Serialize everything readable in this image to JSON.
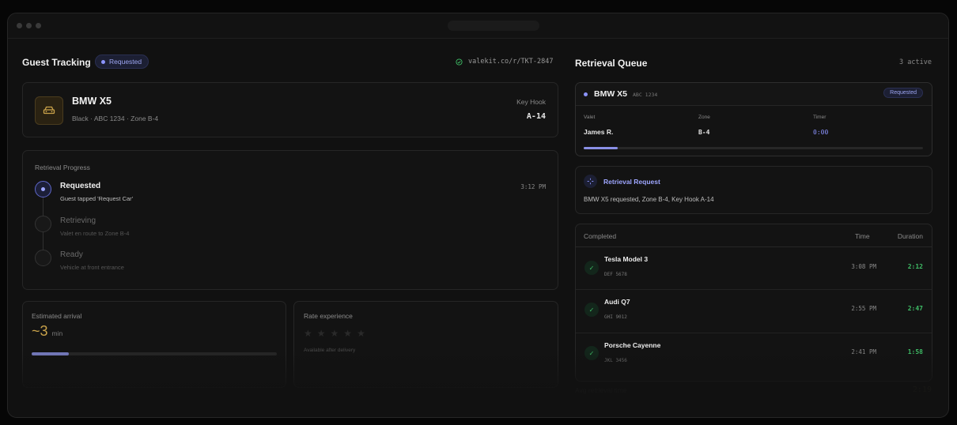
{
  "left": {
    "title": "Guest Tracking",
    "status_pill": "Requested",
    "link": "valekit.co/r/TKT-2847",
    "vehicle": {
      "name": "BMW X5",
      "details": "Black · ABC 1234 · Zone B-4",
      "key_hook_label": "Key Hook",
      "key_hook_value": "A-14"
    },
    "progress": {
      "title": "Retrieval Progress",
      "steps": [
        {
          "title": "Requested",
          "subtitle": "Guest tapped 'Request Car'",
          "time": "3:12 PM",
          "active": true
        },
        {
          "title": "Retrieving",
          "subtitle": "Valet en route to Zone B-4",
          "time": "",
          "active": false
        },
        {
          "title": "Ready",
          "subtitle": "Vehicle at front entrance",
          "time": "",
          "active": false
        }
      ]
    },
    "eta": {
      "label": "Estimated arrival",
      "value": "~3",
      "unit": "min",
      "progress": 0.15
    },
    "rating": {
      "label": "Rate experience",
      "note": "Available after delivery"
    }
  },
  "right": {
    "title": "Retrieval Queue",
    "active_count": "3 active",
    "current": {
      "name": "BMW X5",
      "plate": "ABC 1234",
      "status": "Requested",
      "valet_label": "Valet",
      "valet": "James R.",
      "zone_label": "Zone",
      "zone": "B-4",
      "timer_label": "Timer",
      "timer": "0:00",
      "progress": 0.1
    },
    "request": {
      "title": "Retrieval Request",
      "text": "BMW X5 requested, Zone B-4, Key Hook A-14"
    },
    "completed": {
      "header": "Completed",
      "col_time": "Time",
      "col_duration": "Duration",
      "rows": [
        {
          "name": "Tesla Model 3",
          "plate": "DEF 5678",
          "time": "3:08 PM",
          "duration": "2:12"
        },
        {
          "name": "Audi Q7",
          "plate": "GHI 9012",
          "time": "2:55 PM",
          "duration": "2:47"
        },
        {
          "name": "Porsche Cayenne",
          "plate": "JKL 3456",
          "time": "2:41 PM",
          "duration": "1:58"
        }
      ]
    },
    "avg_label": "Avg retrieval time",
    "avg_value": "2:19"
  },
  "colors": {
    "accent": "#8c94ff",
    "success": "#3fbf67",
    "gold": "#c9a24a"
  }
}
